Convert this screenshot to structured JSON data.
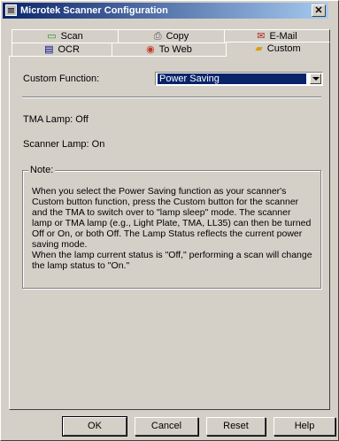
{
  "window": {
    "title": "Microtek Scanner Configuration",
    "close_glyph": "✕"
  },
  "tabs_row1": [
    {
      "label": "Scan",
      "icon": "scan-icon"
    },
    {
      "label": "Copy",
      "icon": "copy-icon"
    },
    {
      "label": "E-Mail",
      "icon": "email-icon"
    }
  ],
  "tabs_row2": [
    {
      "label": "OCR",
      "icon": "ocr-icon"
    },
    {
      "label": "To Web",
      "icon": "web-icon"
    },
    {
      "label": "Custom",
      "icon": "custom-icon"
    }
  ],
  "custom": {
    "function_label": "Custom Function:",
    "function_value": "Power Saving",
    "tma_lamp": "TMA Lamp: Off",
    "scanner_lamp": "Scanner Lamp: On"
  },
  "note": {
    "title": "Note:",
    "paragraph1": "When you select the Power Saving function as your scanner's Custom button function, press the Custom button for the scanner and the TMA to switch over to  \"lamp sleep\" mode. The scanner lamp or TMA lamp (e.g., Light Plate, TMA, LL35) can then be turned Off or On, or both Off. The Lamp Status reflects the current power saving mode.",
    "paragraph2": "When the lamp current status is \"Off,\" performing a scan will change the lamp status to \"On.\""
  },
  "buttons": {
    "ok": "OK",
    "cancel": "Cancel",
    "reset": "Reset",
    "help": "Help"
  },
  "colors": {
    "titlebar_start": "#0a246a",
    "titlebar_end": "#a6caf0",
    "selection": "#0a246a",
    "face": "#d4d0c8"
  }
}
